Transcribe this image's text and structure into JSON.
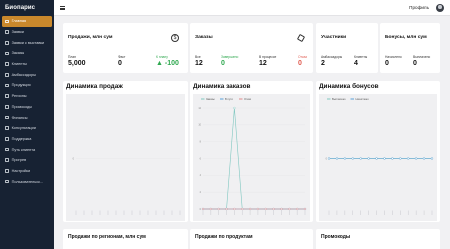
{
  "brand": "Биопарис",
  "sidebar": {
    "items": [
      {
        "label": "Главная",
        "icon": "home-icon",
        "active": true
      },
      {
        "label": "Заявки",
        "icon": "list-icon"
      },
      {
        "label": "Заявки с выставки",
        "icon": "list-icon"
      },
      {
        "label": "Заказы",
        "icon": "box-icon"
      },
      {
        "label": "Клиенты",
        "icon": "users-icon"
      },
      {
        "label": "Амбассадоры",
        "icon": "users-icon"
      },
      {
        "label": "Продукция",
        "icon": "box-icon"
      },
      {
        "label": "Регионы",
        "icon": "map-icon"
      },
      {
        "label": "Промокоды",
        "icon": "tag-icon"
      },
      {
        "label": "Финансы",
        "icon": "wallet-icon"
      },
      {
        "label": "Консультации",
        "icon": "chat-icon"
      },
      {
        "label": "Поддержка",
        "icon": "help-icon"
      },
      {
        "label": "Путь клиента",
        "icon": "route-icon"
      },
      {
        "label": "Прогрев",
        "icon": "fire-icon"
      },
      {
        "label": "Настройки",
        "icon": "gear-icon"
      },
      {
        "label": "Пользовательск...",
        "icon": "user-icon"
      }
    ]
  },
  "topbar": {
    "profile_label": "Профиль"
  },
  "cards": {
    "sales": {
      "title": "Продажи, млн сум",
      "plan_label": "План",
      "plan_value": "5,000",
      "fact_label": "Факт",
      "fact_value": "0",
      "to_plan_label": "К плану",
      "to_plan_value": "-100"
    },
    "orders": {
      "title": "Заказы",
      "all_label": "Все",
      "all_value": "12",
      "done_label": "Завершено",
      "done_value": "0",
      "process_label": "В процессе",
      "process_value": "12",
      "cancel_label": "Отказ",
      "cancel_value": "0"
    },
    "participants": {
      "title": "Участники",
      "amb_label": "Амбассадоры",
      "amb_value": "2",
      "clients_label": "Клиенты",
      "clients_value": "4"
    },
    "bonuses": {
      "title": "Бонусы, млн сум",
      "accrued_label": "Начислено",
      "accrued_value": "0",
      "paid_label": "Выплачено",
      "paid_value": "0"
    }
  },
  "charts_titles": {
    "sales": "Динамика продаж",
    "orders": "Динамика заказов",
    "bonuses": "Динамика бонусов"
  },
  "bottom": {
    "regions": "Продажи по регионам, млн сум",
    "products": "Продажи по продуктам",
    "promos": "Промокоды"
  },
  "colors": {
    "sidebar_bg": "#172233",
    "accent": "#c9882c",
    "green": "#2fa84f",
    "red": "#e05a4f"
  },
  "chart_data": [
    {
      "type": "line",
      "title": "Динамика продаж",
      "categories": [
        "",
        "",
        "",
        "",
        "",
        "",
        "",
        "",
        "",
        "",
        "",
        "",
        "",
        ""
      ],
      "series": [],
      "ylim": [
        -1,
        1
      ],
      "yticks": [
        "0"
      ]
    },
    {
      "type": "line",
      "title": "Динамика заказов",
      "categories": [
        "",
        "",
        "",
        "",
        "",
        "",
        "",
        "",
        "",
        "",
        "",
        "",
        "",
        ""
      ],
      "series": [
        {
          "name": "Заказы",
          "color": "#7fc7c0",
          "values": [
            0,
            0,
            0,
            0,
            12,
            0,
            0,
            0,
            0,
            0,
            0,
            0,
            0,
            0
          ]
        },
        {
          "name": "В пути",
          "color": "#5aa0d8",
          "values": [
            0,
            0,
            0,
            0,
            0,
            0,
            0,
            0,
            0,
            0,
            0,
            0,
            0,
            0
          ]
        },
        {
          "name": "Отказ",
          "color": "#e08a8a",
          "values": [
            0,
            0,
            0,
            0,
            0,
            0,
            0,
            0,
            0,
            0,
            0,
            0,
            0,
            0
          ]
        }
      ],
      "ylim": [
        0,
        12
      ],
      "yticks": [
        "0",
        "2",
        "4",
        "6",
        "8",
        "10",
        "12"
      ]
    },
    {
      "type": "line",
      "title": "Динамика бонусов",
      "categories": [
        "",
        "",
        "",
        "",
        "",
        "",
        "",
        "",
        "",
        "",
        "",
        "",
        "",
        ""
      ],
      "series": [
        {
          "name": "Выплачено",
          "color": "#7fc7c0",
          "values": [
            0,
            0,
            0,
            0,
            0,
            0,
            0,
            0,
            0,
            0,
            0,
            0,
            0,
            0
          ]
        },
        {
          "name": "Начислено",
          "color": "#5aa0d8",
          "values": [
            0,
            0,
            0,
            0,
            0,
            0,
            0,
            0,
            0,
            0,
            0,
            0,
            0,
            0
          ]
        }
      ],
      "ylim": [
        -1,
        1
      ],
      "yticks": [
        "0"
      ]
    }
  ]
}
